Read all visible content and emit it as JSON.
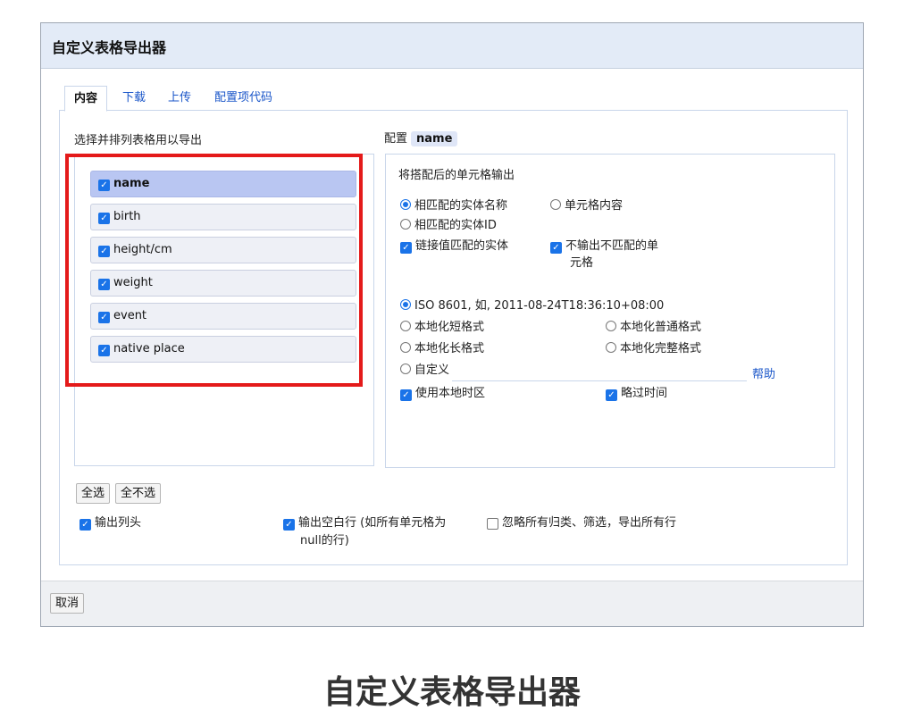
{
  "dialog": {
    "title": "自定义表格导出器",
    "tabs": [
      "内容",
      "下载",
      "上传",
      "配置项代码"
    ],
    "select_label": "选择并排列表格用以导出",
    "config_label": "配置",
    "config_name": "name",
    "fields": [
      {
        "label": "name",
        "checked": true,
        "selected": true
      },
      {
        "label": "birth",
        "checked": true
      },
      {
        "label": "height/cm",
        "checked": true
      },
      {
        "label": "weight",
        "checked": true
      },
      {
        "label": "event",
        "checked": true
      },
      {
        "label": "native place",
        "checked": true
      }
    ],
    "right": {
      "section_title": "将搭配后的单元格输出",
      "opt_entity_name": "相匹配的实体名称",
      "opt_cell_content": "单元格内容",
      "opt_entity_id": "相匹配的实体ID",
      "chk_link": "链接值匹配的实体",
      "chk_no_unmatched_1": "不输出不匹配的单",
      "chk_no_unmatched_2": "元格",
      "date_iso": "ISO 8601, 如, 2011-08-24T18:36:10+08:00",
      "date_local_short": "本地化短格式",
      "date_local_normal": "本地化普通格式",
      "date_local_long": "本地化长格式",
      "date_local_full": "本地化完整格式",
      "date_custom": "自定义",
      "help": "帮助",
      "chk_use_local_tz": "使用本地时区",
      "chk_skip_time": "略过时间"
    },
    "buttons": {
      "select_all": "全选",
      "select_none": "全不选",
      "cancel": "取消"
    },
    "bottom_options": {
      "output_header": "输出列头",
      "output_empty_1": "输出空白行 (如所有单元格为",
      "output_empty_2": "null的行)",
      "ignore_facets": "忽略所有归类、筛选，导出所有行"
    }
  },
  "caption": "自定义表格导出器"
}
